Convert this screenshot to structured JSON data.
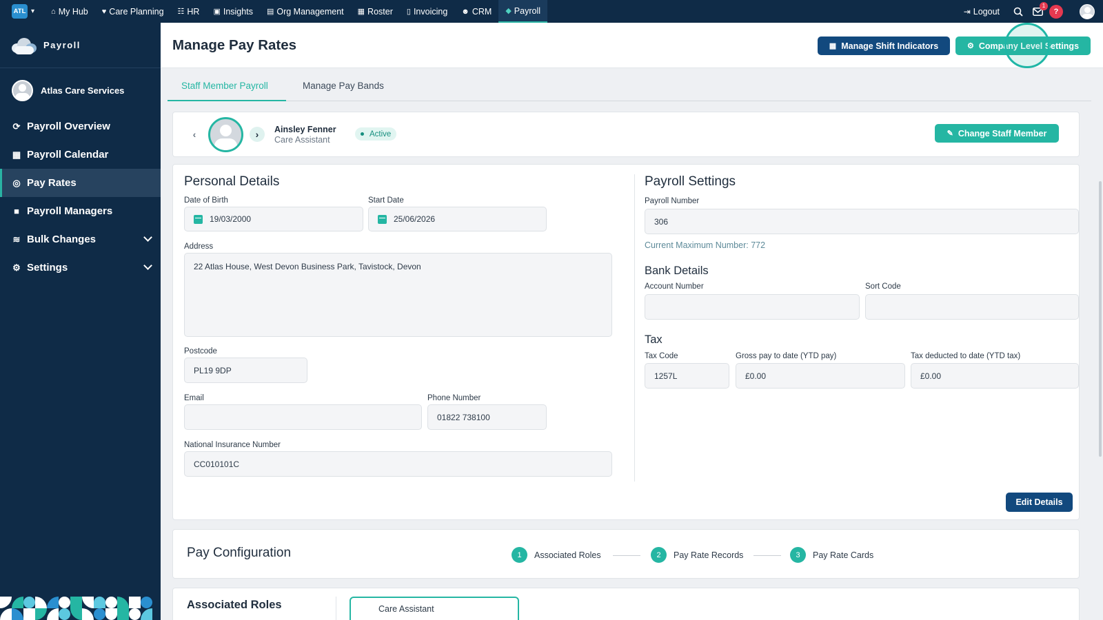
{
  "topnav": {
    "brand_badge": "ATL",
    "items": [
      {
        "label": "My Hub",
        "icon": "home-icon",
        "glyph": "⌂"
      },
      {
        "label": "Care Planning",
        "icon": "heart-icon",
        "glyph": "♥"
      },
      {
        "label": "HR",
        "icon": "people-icon",
        "glyph": "☷"
      },
      {
        "label": "Insights",
        "icon": "chart-icon",
        "glyph": "▣"
      },
      {
        "label": "Org Management",
        "icon": "building-icon",
        "glyph": "▤"
      },
      {
        "label": "Roster",
        "icon": "calendar-icon",
        "glyph": "▦"
      },
      {
        "label": "Invoicing",
        "icon": "document-icon",
        "glyph": "▯"
      },
      {
        "label": "CRM",
        "icon": "contacts-icon",
        "glyph": "☻"
      },
      {
        "label": "Payroll",
        "icon": "money-icon",
        "glyph": "◆"
      }
    ],
    "active_index": 8,
    "logout_label": "Logout",
    "notification_count": "1",
    "help_glyph": "?"
  },
  "sidebar": {
    "module_title": "Payroll",
    "org_name": "Atlas Care Services",
    "items": [
      {
        "label": "Payroll Overview",
        "icon": "refresh-icon",
        "glyph": "⟳"
      },
      {
        "label": "Payroll Calendar",
        "icon": "calendar-icon",
        "glyph": "▦"
      },
      {
        "label": "Pay Rates",
        "icon": "coins-icon",
        "glyph": "◎"
      },
      {
        "label": "Payroll Managers",
        "icon": "lock-icon",
        "glyph": "■"
      },
      {
        "label": "Bulk Changes",
        "icon": "layers-icon",
        "glyph": "≋"
      },
      {
        "label": "Settings",
        "icon": "gear-icon",
        "glyph": "⚙"
      }
    ],
    "active_index": 2
  },
  "header": {
    "title": "Manage Pay Rates",
    "manage_shift_label": "Manage Shift Indicators",
    "company_settings_label": "Company Level Settings"
  },
  "tabs": [
    {
      "label": "Staff Member Payroll"
    },
    {
      "label": "Manage Pay Bands"
    }
  ],
  "staff": {
    "name": "Ainsley Fenner",
    "role": "Care Assistant",
    "status": "Active",
    "change_label": "Change Staff Member"
  },
  "personal": {
    "title": "Personal Details",
    "dob_label": "Date of Birth",
    "dob": "19/03/2000",
    "start_label": "Start Date",
    "start": "25/06/2026",
    "address_label": "Address",
    "address": "22 Atlas House, West Devon Business Park, Tavistock, Devon",
    "postcode_label": "Postcode",
    "postcode": "PL19 9DP",
    "email_label": "Email",
    "email": "",
    "phone_label": "Phone Number",
    "phone": "01822 738100",
    "ni_label": "National Insurance Number",
    "ni": "CC010101C"
  },
  "payroll_settings": {
    "title": "Payroll Settings",
    "number_label": "Payroll Number",
    "number": "306",
    "max_hint": "Current Maximum Number: 772",
    "bank_title": "Bank Details",
    "account_label": "Account Number",
    "account": "",
    "sort_label": "Sort Code",
    "sort": "",
    "tax_title": "Tax",
    "tax_code_label": "Tax Code",
    "tax_code": "1257L",
    "gross_label": "Gross pay to date (YTD pay)",
    "gross": "£0.00",
    "tax_ded_label": "Tax deducted to date (YTD tax)",
    "tax_ded": "£0.00"
  },
  "edit_label": "Edit Details",
  "pay_config": {
    "title": "Pay Configuration",
    "steps": [
      {
        "num": "1",
        "label": "Associated Roles"
      },
      {
        "num": "2",
        "label": "Pay Rate Records"
      },
      {
        "num": "3",
        "label": "Pay Rate Cards"
      }
    ]
  },
  "roles": {
    "title": "Associated Roles",
    "chip": "Care Assistant"
  },
  "colors": {
    "navy": "#0f2b47",
    "teal": "#25b6a3",
    "button_navy": "#12497e",
    "danger": "#e53950"
  }
}
